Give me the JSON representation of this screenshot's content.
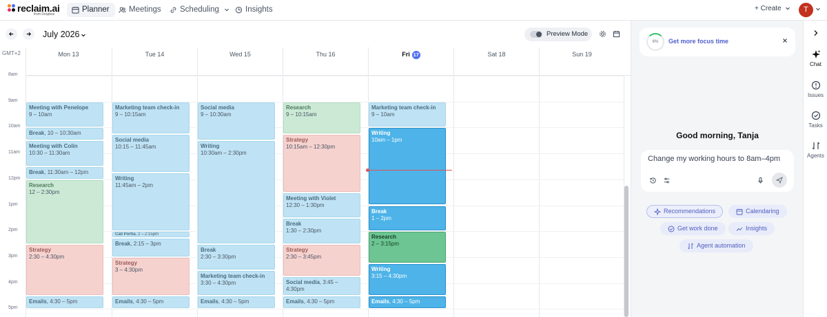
{
  "brand": {
    "name": "reclaim.ai",
    "sub": "from Dropbox"
  },
  "nav": [
    {
      "label": "Planner",
      "icon": "planner-icon",
      "active": true
    },
    {
      "label": "Meetings",
      "icon": "meetings-icon"
    },
    {
      "label": "Scheduling",
      "icon": "scheduling-icon"
    },
    {
      "label": "Insights",
      "icon": "insights-icon"
    }
  ],
  "header": {
    "create_label": "+ Create",
    "avatar_initial": "T"
  },
  "toolbar": {
    "month": "July 2026",
    "preview_mode": "Preview Mode"
  },
  "calendar": {
    "timezone": "GMT+2",
    "days": [
      {
        "label": "Mon 13"
      },
      {
        "label": "Tue 14"
      },
      {
        "label": "Wed 15"
      },
      {
        "label": "Thu 16"
      },
      {
        "label": "Fri",
        "badge": "17",
        "today": true
      },
      {
        "label": "Sat 18"
      },
      {
        "label": "Sun 19"
      }
    ],
    "hours": [
      "8am",
      "9am",
      "10am",
      "11am",
      "12pm",
      "1pm",
      "2pm",
      "3pm",
      "4pm",
      "5pm"
    ],
    "events": [
      {
        "day": 0,
        "start": 9,
        "end": 10,
        "title": "Meeting with Penelope",
        "time": "9 – 10am",
        "color": "blue"
      },
      {
        "day": 0,
        "start": 10,
        "end": 10.5,
        "title": "Break",
        "time": "10 – 10:30am",
        "color": "blue",
        "inline": true
      },
      {
        "day": 0,
        "start": 10.5,
        "end": 11.5,
        "title": "Meeting with Colin",
        "time": "10:30 – 11:30am",
        "color": "blue"
      },
      {
        "day": 0,
        "start": 11.5,
        "end": 12,
        "title": "Break",
        "time": "11:30am – 12pm",
        "color": "blue",
        "inline": true
      },
      {
        "day": 0,
        "start": 12,
        "end": 14.5,
        "title": "Research",
        "time": "12 – 2:30pm",
        "color": "green"
      },
      {
        "day": 0,
        "start": 14.5,
        "end": 16.5,
        "title": "Strategy",
        "time": "2:30 – 4:30pm",
        "color": "red"
      },
      {
        "day": 0,
        "start": 16.5,
        "end": 17,
        "title": "Emails",
        "time": "4:30 – 5pm",
        "color": "blue",
        "inline": true
      },
      {
        "day": 1,
        "start": 9,
        "end": 10.25,
        "title": "Marketing team check-in",
        "time": "9 – 10:15am",
        "color": "blue"
      },
      {
        "day": 1,
        "start": 10.25,
        "end": 11.75,
        "title": "Social media",
        "time": "10:15 – 11:45am",
        "color": "blue"
      },
      {
        "day": 1,
        "start": 11.75,
        "end": 14,
        "title": "Writing",
        "time": "11:45am – 2pm",
        "color": "blue"
      },
      {
        "day": 1,
        "start": 14,
        "end": 14.25,
        "title": "Call Portia",
        "time": "2 – 2:15pm",
        "color": "blue",
        "inline": true,
        "tiny": true
      },
      {
        "day": 1,
        "start": 14.25,
        "end": 15,
        "title": "Break",
        "time": "2:15 – 3pm",
        "color": "blue",
        "inline": true
      },
      {
        "day": 1,
        "start": 15,
        "end": 16.5,
        "title": "Strategy",
        "time": "3 – 4:30pm",
        "color": "red"
      },
      {
        "day": 1,
        "start": 16.5,
        "end": 17,
        "title": "Emails",
        "time": "4:30 – 5pm",
        "color": "blue",
        "inline": true
      },
      {
        "day": 2,
        "start": 9,
        "end": 10.5,
        "title": "Social media",
        "time": "9 – 10:30am",
        "color": "blue"
      },
      {
        "day": 2,
        "start": 10.5,
        "end": 14.5,
        "title": "Writing",
        "time": "10:30am – 2:30pm",
        "color": "blue"
      },
      {
        "day": 2,
        "start": 14.5,
        "end": 15.5,
        "title": "Break",
        "time": "2:30 – 3:30pm",
        "color": "blue"
      },
      {
        "day": 2,
        "start": 15.5,
        "end": 16.5,
        "title": "Marketing team check-in",
        "time": "3:30 – 4:30pm",
        "color": "blue"
      },
      {
        "day": 2,
        "start": 16.5,
        "end": 17,
        "title": "Emails",
        "time": "4:30 – 5pm",
        "color": "blue",
        "inline": true
      },
      {
        "day": 3,
        "start": 9,
        "end": 10.25,
        "title": "Research",
        "time": "9 – 10:15am",
        "color": "green"
      },
      {
        "day": 3,
        "start": 10.25,
        "end": 12.5,
        "title": "Strategy",
        "time": "10:15am – 12:30pm",
        "color": "red"
      },
      {
        "day": 3,
        "start": 12.5,
        "end": 13.5,
        "title": "Meeting with Violet",
        "time": "12:30 – 1:30pm",
        "color": "blue"
      },
      {
        "day": 3,
        "start": 13.5,
        "end": 14.5,
        "title": "Break",
        "time": "1:30 – 2:30pm",
        "color": "blue"
      },
      {
        "day": 3,
        "start": 14.5,
        "end": 15.75,
        "title": "Strategy",
        "time": "2:30 – 3:45pm",
        "color": "red"
      },
      {
        "day": 3,
        "start": 15.75,
        "end": 16.5,
        "title": "Social media",
        "time": "3:45 – 4:30pm",
        "color": "blue",
        "inline": true
      },
      {
        "day": 3,
        "start": 16.5,
        "end": 17,
        "title": "Emails",
        "time": "4:30 – 5pm",
        "color": "blue",
        "inline": true
      },
      {
        "day": 4,
        "start": 9,
        "end": 10,
        "title": "Marketing team check-in",
        "time": "9 – 10am",
        "color": "blue"
      },
      {
        "day": 4,
        "start": 10,
        "end": 13,
        "title": "Writing",
        "time": "10am – 1pm",
        "color": "sblue"
      },
      {
        "day": 4,
        "start": 13,
        "end": 14,
        "title": "Break",
        "time": "1 – 2pm",
        "color": "sblue"
      },
      {
        "day": 4,
        "start": 14,
        "end": 15.25,
        "title": "Research",
        "time": "2 – 3:15pm",
        "color": "sgreen"
      },
      {
        "day": 4,
        "start": 15.25,
        "end": 16.5,
        "title": "Writing",
        "time": "3:15 – 4:30pm",
        "color": "sblue"
      },
      {
        "day": 4,
        "start": 16.5,
        "end": 17,
        "title": "Emails",
        "time": "4:30 – 5pm",
        "color": "sblue",
        "inline": true
      }
    ]
  },
  "assistant": {
    "focus": {
      "percent": "6%",
      "label": "Get more focus time"
    },
    "greeting": "Good morning, Tanja",
    "input_value": "Change my working hours to 8am–4pm",
    "suggestions": [
      {
        "label": "Recommendations",
        "icon": "sparkle-icon",
        "selected": true
      },
      {
        "label": "Calendaring",
        "icon": "calendar-icon"
      },
      {
        "label": "Get work done",
        "icon": "check-circle-icon"
      },
      {
        "label": "Insights",
        "icon": "trend-icon"
      },
      {
        "label": "Agent automation",
        "icon": "automation-icon"
      }
    ]
  },
  "rail": [
    {
      "label": "Chat",
      "icon": "sparkle-icon",
      "active": true
    },
    {
      "label": "Issues",
      "icon": "alert-icon"
    },
    {
      "label": "Tasks",
      "icon": "task-check-icon"
    },
    {
      "label": "Agents",
      "icon": "agents-icon"
    }
  ],
  "colors": {
    "accent": "#4f6ef7",
    "avatar": "#c2321f",
    "now_line": "#e05555"
  }
}
